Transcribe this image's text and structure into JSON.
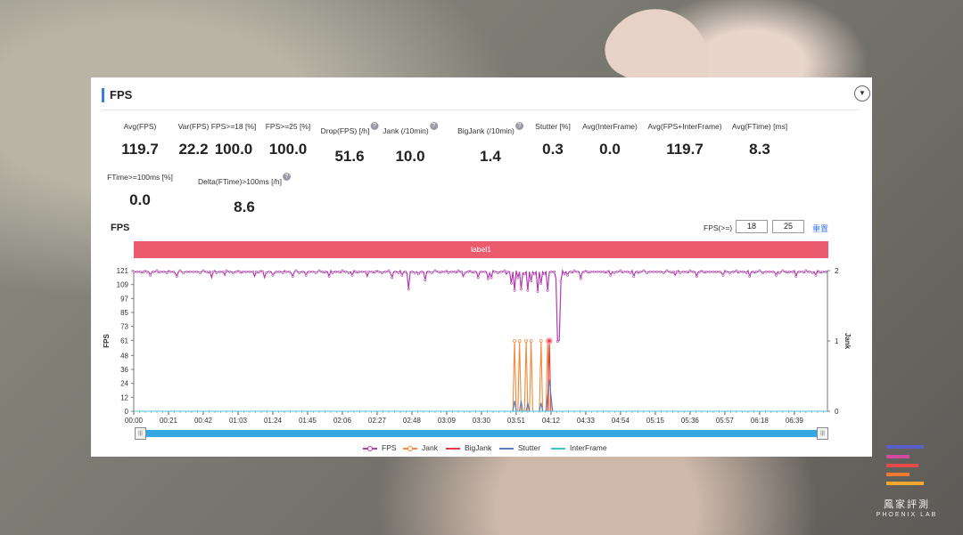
{
  "panel": {
    "title": "FPS",
    "collapse_icon": "chevron-down-icon"
  },
  "metrics_row1": [
    {
      "label": "Avg(FPS)",
      "value": "119.7",
      "help": false
    },
    {
      "label": "Var(FPS)",
      "value": "22.2",
      "help": false
    },
    {
      "label": "FPS>=18 [%]",
      "value": "100.0",
      "help": false
    },
    {
      "label": "FPS>=25 [%]",
      "value": "100.0",
      "help": false
    },
    {
      "label": "Drop(FPS) [/h]",
      "value": "51.6",
      "help": true
    },
    {
      "label": "Jank (/10min)",
      "value": "10.0",
      "help": true
    },
    {
      "label": "BigJank (/10min)",
      "value": "1.4",
      "help": true
    },
    {
      "label": "Stutter [%]",
      "value": "0.3",
      "help": false
    },
    {
      "label": "Avg(InterFrame)",
      "value": "0.0",
      "help": false
    },
    {
      "label": "Avg(FPS+InterFrame)",
      "value": "119.7",
      "help": false
    },
    {
      "label": "Avg(FTime) [ms]",
      "value": "8.3",
      "help": false
    }
  ],
  "metrics_row2": [
    {
      "label": "FTime>=100ms [%]",
      "value": "0.0",
      "help": false
    },
    {
      "label": "Delta(FTime)>100ms [/h]",
      "value": "8.6",
      "help": true
    }
  ],
  "chart_header": {
    "title": "FPS",
    "threshold_label": "FPS(>=)",
    "threshold1": "18",
    "threshold2": "25",
    "reset_label": "重置"
  },
  "label_band": "label1",
  "logo": {
    "text": "鳳家評測",
    "sub": "PHOENIX LAB"
  },
  "chart_data": {
    "type": "line",
    "title": "FPS",
    "ylabel": "FPS",
    "y2label": "Jank",
    "ylim": [
      0,
      121
    ],
    "y2lim": [
      0,
      2
    ],
    "yticks": [
      "0",
      "12",
      "24",
      "36",
      "48",
      "61",
      "73",
      "85",
      "97",
      "109",
      "121"
    ],
    "y2ticks": [
      "0",
      "1",
      "2"
    ],
    "xticks": [
      "00:00",
      "00:21",
      "00:42",
      "01:03",
      "01:24",
      "01:45",
      "02:06",
      "02:27",
      "02:48",
      "03:09",
      "03:30",
      "03:51",
      "04:12",
      "04:33",
      "04:54",
      "05:15",
      "05:36",
      "05:57",
      "06:18",
      "06:39"
    ],
    "x_end_seconds": 419,
    "series": [
      {
        "name": "FPS",
        "color": "#b23cb0",
        "axis": "left",
        "baseline": 120,
        "dips": [
          [
            10,
            117
          ],
          [
            26,
            116
          ],
          [
            47,
            115
          ],
          [
            55,
            117
          ],
          [
            73,
            116
          ],
          [
            79,
            115
          ],
          [
            84,
            117
          ],
          [
            96,
            116
          ],
          [
            104,
            117
          ],
          [
            118,
            116
          ],
          [
            132,
            117
          ],
          [
            141,
            116
          ],
          [
            156,
            115
          ],
          [
            162,
            117
          ],
          [
            176,
            116
          ],
          [
            186,
            117
          ],
          [
            199,
            116
          ],
          [
            216,
            115
          ],
          [
            228,
            116
          ],
          [
            240,
            118
          ],
          [
            246,
            116
          ],
          [
            262,
            117
          ],
          [
            288,
            117
          ],
          [
            302,
            116
          ],
          [
            327,
            117
          ],
          [
            340,
            116
          ],
          [
            356,
            117
          ],
          [
            372,
            116
          ],
          [
            388,
            117
          ],
          [
            400,
            116
          ],
          [
            412,
            117
          ]
        ],
        "events": [
          [
            164,
            120
          ],
          [
            166,
            105
          ],
          [
            168,
            120
          ],
          [
            172,
            118
          ],
          [
            176,
            113
          ],
          [
            186,
            120
          ],
          [
            208,
            115
          ],
          [
            210,
            120
          ],
          [
            214,
            114
          ],
          [
            218,
            120
          ],
          [
            225,
            118
          ],
          [
            228,
            110
          ],
          [
            230,
            104
          ],
          [
            232,
            115
          ],
          [
            234,
            105
          ],
          [
            236,
            118
          ],
          [
            238,
            104
          ],
          [
            240,
            112
          ],
          [
            242,
            118
          ],
          [
            244,
            103
          ],
          [
            246,
            110
          ],
          [
            248,
            118
          ],
          [
            250,
            104
          ],
          [
            252,
            120
          ],
          [
            255,
            114
          ],
          [
            256,
            60
          ],
          [
            257,
            61
          ],
          [
            258,
            112
          ],
          [
            260,
            118
          ],
          [
            264,
            120
          ],
          [
            270,
            114
          ],
          [
            276,
            120
          ]
        ]
      },
      {
        "name": "Jank",
        "color": "#f08a3c",
        "axis": "right",
        "points": [
          [
            229,
            0
          ],
          [
            230,
            1
          ],
          [
            231,
            0
          ],
          [
            232,
            0
          ],
          [
            233,
            1
          ],
          [
            234,
            0
          ],
          [
            236,
            0
          ],
          [
            237,
            1
          ],
          [
            238,
            0
          ],
          [
            239,
            0
          ],
          [
            240,
            1
          ],
          [
            241,
            0
          ],
          [
            245,
            0
          ],
          [
            246,
            1
          ],
          [
            247,
            0
          ],
          [
            249,
            0
          ],
          [
            250,
            1
          ],
          [
            251,
            0
          ]
        ]
      },
      {
        "name": "BigJank",
        "color": "#e23b3b",
        "axis": "right",
        "points": [
          [
            250,
            0
          ],
          [
            251,
            1
          ],
          [
            252,
            0
          ]
        ]
      },
      {
        "name": "Stutter",
        "color": "#5b7fc0",
        "axis": "right",
        "points": [
          [
            229,
            0
          ],
          [
            230,
            0.15
          ],
          [
            231,
            0
          ],
          [
            233,
            0
          ],
          [
            234,
            0.15
          ],
          [
            235,
            0
          ],
          [
            237,
            0
          ],
          [
            238,
            0.12
          ],
          [
            239,
            0
          ],
          [
            245,
            0
          ],
          [
            246,
            0.12
          ],
          [
            247,
            0
          ],
          [
            249,
            0
          ],
          [
            251,
            0.45
          ],
          [
            253,
            0
          ]
        ]
      },
      {
        "name": "InterFrame",
        "color": "#42c0d2",
        "axis": "right",
        "points": [
          [
            0,
            0
          ],
          [
            419,
            0
          ]
        ]
      }
    ]
  }
}
